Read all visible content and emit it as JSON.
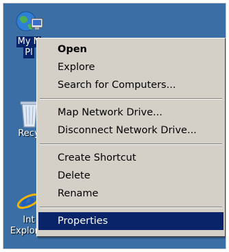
{
  "desktop": {
    "background_color": "#3a6ea5",
    "icons": [
      {
        "name": "network-places",
        "label": "My Network Places",
        "visible_text_line1": "My N",
        "visible_text_line2": "Pl",
        "icon": "network-globe-icon"
      },
      {
        "name": "recycle-bin",
        "label": "Recycle Bin",
        "visible_text": "Recy",
        "icon": "recycle-bin-icon"
      },
      {
        "name": "internet-explorer",
        "label": "Internet Explorer",
        "visible_text_line1": "Int",
        "visible_text_line2": "Explorer",
        "icon": "internet-explorer-icon"
      }
    ]
  },
  "context_menu": {
    "groups": [
      {
        "items": [
          {
            "label": "Open",
            "bold": true
          },
          {
            "label": "Explore"
          },
          {
            "label": "Search for Computers..."
          }
        ]
      },
      {
        "items": [
          {
            "label": "Map Network Drive..."
          },
          {
            "label": "Disconnect Network Drive..."
          }
        ]
      },
      {
        "items": [
          {
            "label": "Create Shortcut"
          },
          {
            "label": "Delete"
          },
          {
            "label": "Rename"
          }
        ]
      },
      {
        "items": [
          {
            "label": "Properties",
            "highlighted": true
          }
        ]
      }
    ],
    "highlight_color": "#0a246a",
    "menu_color": "#d4d0c8"
  }
}
